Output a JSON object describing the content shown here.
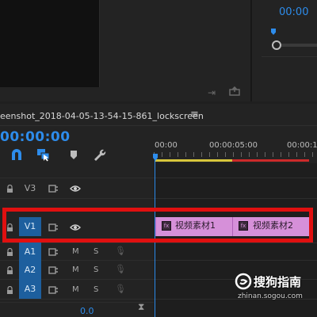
{
  "program_monitor": {
    "timecode": "00:00"
  },
  "timeline": {
    "tab_title": "eenshot_2018-04-05-13-54-15-861_lockscreen",
    "menu_glyph": "≡",
    "timecode": "00:00:00",
    "ruler": [
      "00:00",
      "00:00:05:00",
      "00:00:1"
    ],
    "tracks": [
      {
        "name": "V3",
        "kind": "video"
      },
      {
        "name": "V1",
        "kind": "video"
      },
      {
        "name": "A1",
        "kind": "audio",
        "mute": "M",
        "solo": "S"
      },
      {
        "name": "A2",
        "kind": "audio",
        "mute": "M",
        "solo": "S"
      },
      {
        "name": "A3",
        "kind": "audio",
        "mute": "M",
        "solo": "S"
      }
    ],
    "clips": [
      {
        "name": "视频素材1",
        "fx": "fx"
      },
      {
        "name": "视频素材2",
        "fx": "fx"
      }
    ],
    "volume_readout": "0.0"
  },
  "watermark": {
    "brand": "搜狗指南",
    "url": "zhinan.sogou.com"
  },
  "colors": {
    "accent_blue": "#2d8ceb",
    "clip_pink": "#d690d9",
    "highlight_red": "#e01010",
    "work_area_yellow": "#d7c63c"
  }
}
